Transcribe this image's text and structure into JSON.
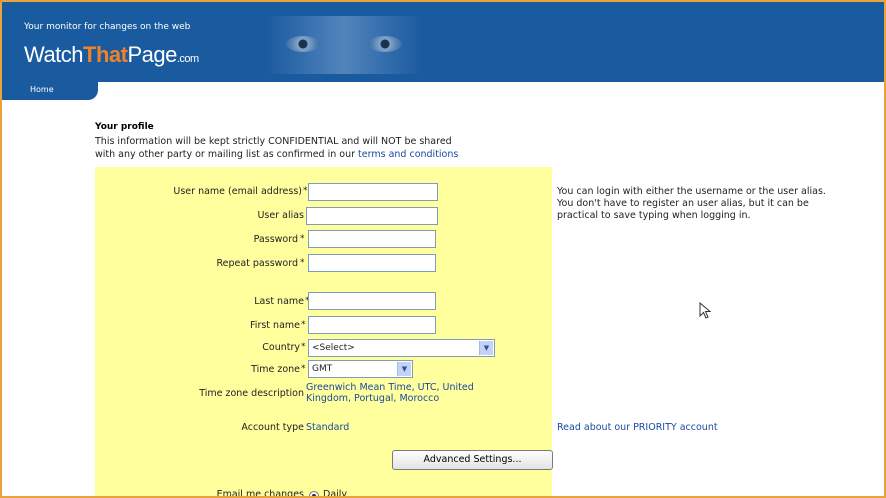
{
  "header": {
    "tagline": "Your monitor for changes on the web",
    "logo_part1": "Watch",
    "logo_part2": "That",
    "logo_part3": "Page",
    "logo_suffix": ".com"
  },
  "nav": {
    "home_label": "Home"
  },
  "profile": {
    "title": "Your profile",
    "text_line1": "This information will be kept strictly CONFIDENTIAL and will NOT be shared",
    "text_line2": "with any other party or mailing list as confirmed in our ",
    "terms_link": "terms and conditions"
  },
  "form": {
    "username_label": "User name (email address)",
    "alias_label": "User alias",
    "password_label": "Password",
    "repeat_password_label": "Repeat password",
    "last_name_label": "Last name",
    "first_name_label": "First name",
    "country_label": "Country",
    "country_value": "<Select>",
    "timezone_label": "Time zone",
    "timezone_value": "GMT",
    "tz_desc_label": "Time zone description",
    "tz_desc_line1": "Greenwich Mean Time, UTC, United",
    "tz_desc_line2": "Kingdom, Portugal, Morocco",
    "account_type_label": "Account type",
    "account_type_value": "Standard",
    "advanced_button": "Advanced Settings...",
    "email_changes_label": "Email me changes",
    "email_changes_option": "Daily",
    "required_mark": "*"
  },
  "side": {
    "login_line1": "You can login with either the username or the user alias.",
    "login_line2": "You don't have to register an user alias, but it can be",
    "login_line3": "practical to save typing when logging in.",
    "priority_link": "Read about our PRIORITY account"
  },
  "colors": {
    "header_blue": "#1a5a9e",
    "form_yellow": "#ffff9e",
    "accent_orange": "#f0822a",
    "frame_orange": "#e8a33c",
    "link_blue": "#1a4aa0"
  }
}
